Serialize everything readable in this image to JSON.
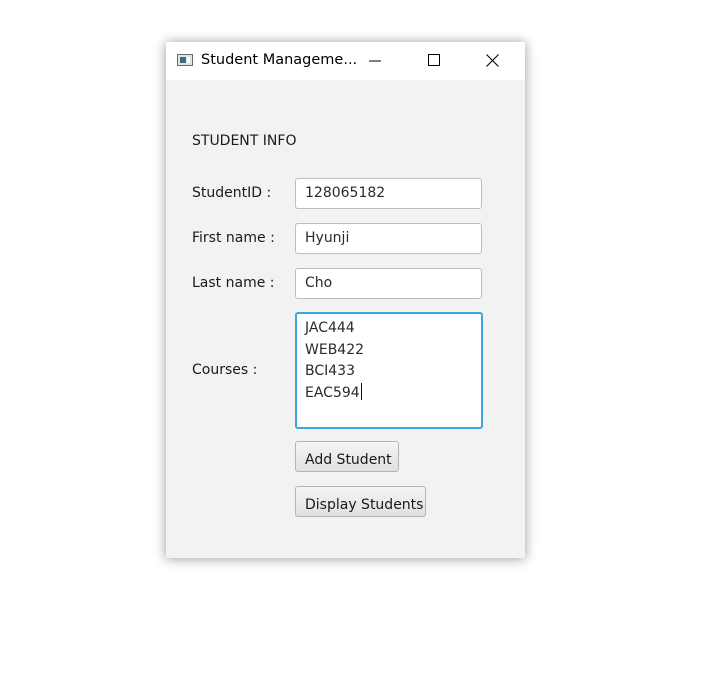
{
  "window": {
    "title": "Student Manageme...",
    "controls": {
      "minimize_icon": "minimize-icon",
      "maximize_icon": "maximize-icon",
      "close_icon": "close-icon"
    }
  },
  "form": {
    "heading": "STUDENT INFO",
    "student_id": {
      "label": "StudentID :",
      "value": "128065182"
    },
    "first_name": {
      "label": "First name :",
      "value": "Hyunji"
    },
    "last_name": {
      "label": "Last name :",
      "value": "Cho"
    },
    "courses": {
      "label": "Courses :",
      "lines": [
        "JAC444",
        "WEB422",
        "BCI433",
        "EAC594"
      ]
    },
    "buttons": {
      "add": "Add Student",
      "display": "Display Students"
    }
  },
  "colors": {
    "focus_border": "#3da6dc",
    "window_bg": "#f2f2f2",
    "titlebar_bg": "#ffffff"
  }
}
